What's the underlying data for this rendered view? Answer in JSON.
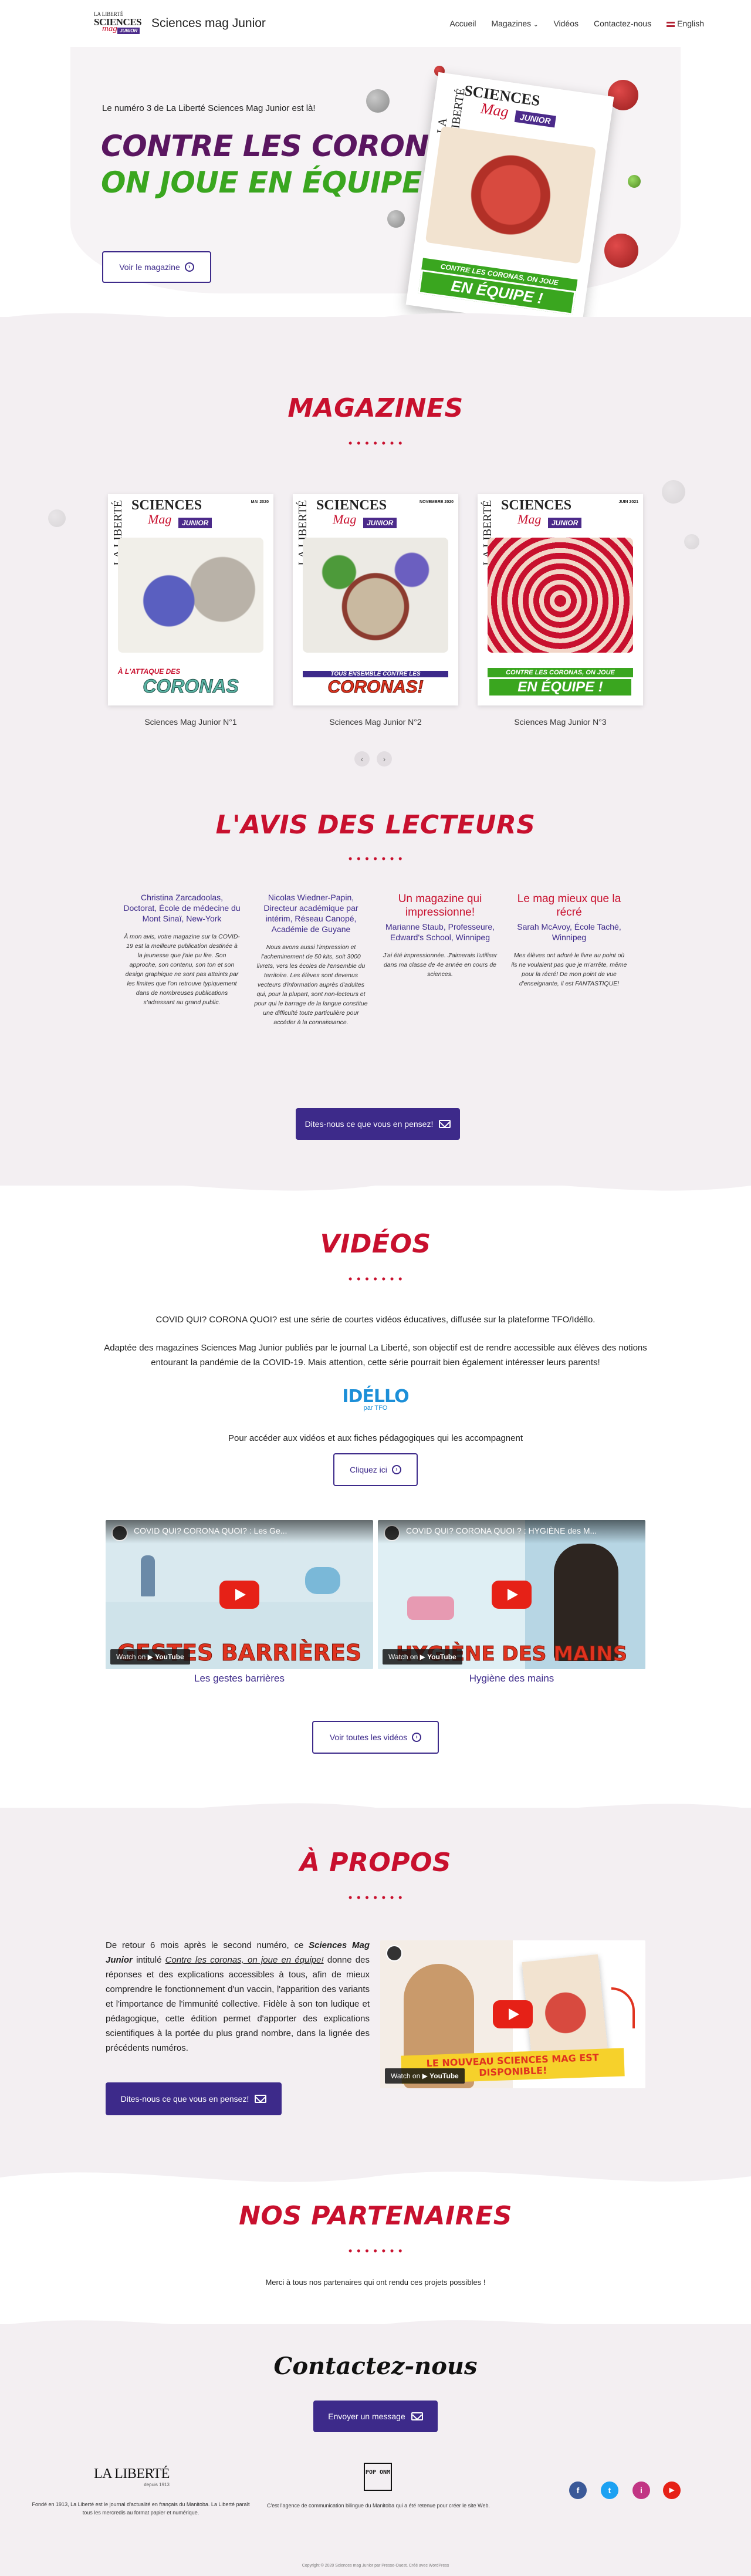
{
  "header": {
    "logo_line1": "LA LIBERTÉ",
    "logo_line2": "SCIENCES",
    "logo_line3": "mag",
    "logo_line4": "JUNIOR",
    "site_title": "Sciences mag Junior",
    "nav": [
      "Accueil",
      "Magazines",
      "Vidéos",
      "Contactez-nous",
      "English"
    ]
  },
  "hero": {
    "intro": "Le numéro 3 de La Liberté Sciences Mag Junior est là!",
    "title_line1": "CONTRE LES CORONAS,",
    "title_line2": "ON JOUE EN ÉQUIPE!",
    "button": "Voir le magazine",
    "cover_brand": "LA LIBERTÉ",
    "cover_sciences": "SCIENCES",
    "cover_mag": "Mag",
    "cover_junior": "JUNIOR",
    "cover_banner_small": "CONTRE LES CORONAS, ON JOUE",
    "cover_banner_big": "EN ÉQUIPE !"
  },
  "magazines": {
    "title": "MAGAZINES",
    "items": [
      {
        "caption": "Sciences Mag Junior N°1",
        "banner_small": "À L'ATTAQUE DES",
        "banner_big": "CORONAS",
        "date": "MAI 2020"
      },
      {
        "caption": "Sciences Mag Junior N°2",
        "banner_small": "TOUS ENSEMBLE CONTRE LES",
        "banner_big": "CORONAS!",
        "date": "NOVEMBRE 2020"
      },
      {
        "caption": "Sciences Mag Junior N°3",
        "banner_small": "CONTRE LES CORONAS, ON JOUE",
        "banner_big": "EN ÉQUIPE !",
        "date": "JUIN 2021"
      }
    ],
    "cover_brand": "LA LIBERTÉ",
    "cover_sciences": "SCIENCES",
    "cover_mag": "Mag",
    "cover_junior": "JUNIOR",
    "prev": "‹",
    "next": "›"
  },
  "reviews": {
    "title": "L'AVIS DES LECTEURS",
    "items": [
      {
        "heading": "",
        "name": "Christina Zarcadoolas, Doctorat, École de médecine du Mont Sinaï, New-York",
        "body": "À mon avis, votre magazine sur la COVID-19 est la meilleure publication destinée à la jeunesse que j'aie pu lire. Son approche, son contenu, son ton et son design graphique ne sont pas atteints par les limites que l'on retrouve typiquement dans de nombreuses publications s'adressant au grand public."
      },
      {
        "heading": "",
        "name": "Nicolas Wiedner-Papin, Directeur académique par intérim, Réseau Canopé, Académie de Guyane",
        "body": "Nous avons aussi l'impression et l'acheminement de 50 kits, soit 3000 livrets, vers les écoles de l'ensemble du territoire. Les élèves sont devenus vecteurs d'information auprès d'adultes qui, pour la plupart, sont non-lecteurs et pour qui le barrage de la langue constitue une difficulté toute particulière pour accéder à la connaissance."
      },
      {
        "heading": "Un magazine qui impressionne!",
        "name": "Marianne Staub, Professeure, Edward's School, Winnipeg",
        "body": "J'ai été impressionnée. J'aimerais l'utiliser dans ma classe de 4e année en cours de sciences."
      },
      {
        "heading": "Le mag mieux que la récré",
        "name": "Sarah McAvoy, École Taché, Winnipeg",
        "body": "Mes élèves ont adoré le livre au point où ils ne voulaient pas que je m'arrête, même pour la récré! De mon point de vue d'enseignante, il est FANTASTIQUE!"
      }
    ],
    "button": "Dites-nous ce que vous en pensez!"
  },
  "videos": {
    "title": "VIDÉOS",
    "p1": "COVID QUI? CORONA QUOI? est une série de courtes vidéos éducatives, diffusée sur la plateforme TFO/Idéllo.",
    "p2a": "Adaptée des magazines Sciences Mag Junior publiés par le journal La Liberté, son objectif est de rendre accessible aux élèves des notions",
    "p2b": "entourant la pandémie de la COVID-19. Mais attention, cette série pourrait bien également intéresser leurs parents!",
    "idello": "IDÉLLO",
    "idello_sub": "par TFO",
    "p3": "Pour accéder aux vidéos et aux fiches pédagogiques qui les accompagnent",
    "click_button": "Cliquez ici",
    "items": [
      {
        "top_title": "COVID QUI? CORONA QUOI? : Les Ge...",
        "overlay": "GESTES BARRIÈRES",
        "caption": "Les gestes barrières"
      },
      {
        "top_title": "COVID QUI? CORONA QUOI ? : HYGIÈNE des M...",
        "overlay": "HYGIÈNE DES MAINS",
        "caption": "Hygiène des mains"
      }
    ],
    "watch_on": "Watch on",
    "youtube": "YouTube",
    "all_button": "Voir toutes les vidéos"
  },
  "about": {
    "title": "À PROPOS",
    "text_1": "De retour 6 mois après le second numéro, ce ",
    "text_em": "Sciences Mag Junior",
    "text_2": " intitulé ",
    "text_u": "Contre les coronas, on joue en équipe!",
    "text_3": " donne des réponses et des explications accessibles à tous, afin de mieux comprendre le fonctionnement d'un vaccin, l'apparition des variants et l'importance de l'immunité collective. Fidèle à son ton ludique et pédagogique, cette édition permet d'apporter des explications scientifiques à la portée du plus grand nombre, dans la lignée des précédents numéros.",
    "button": "Dites-nous ce que vous en pensez!",
    "video_overlay": "LE NOUVEAU SCIENCES MAG EST DISPONIBLE!"
  },
  "partners": {
    "title": "NOS PARTENAIRES",
    "text": "Merci à tous nos partenaires qui ont rendu ces projets possibles !"
  },
  "contact": {
    "title": "Contactez-nous",
    "button": "Envoyer un message"
  },
  "footer": {
    "brand": "LA LIBERTÉ",
    "brand_sub": "depuis 1913",
    "brand_text_a": "Fondé en 1913, La Liberté est le journal d'actualité en français du Manitoba. La Liberté paraît",
    "brand_text_b": "tous les mercredis au format papier et numérique.",
    "pop_logo": "POP ONM",
    "pop_text": "C'est l'agence de communication bilingue du Manitoba qui a été retenue pour créer le site Web.",
    "social": [
      "f",
      "t",
      "i",
      "▶"
    ],
    "social_colors": [
      "#3b5998",
      "#1da1f2",
      "#c13584",
      "#e62117"
    ],
    "copyright": "Copyright © 2020 Sciences mag Junior par Presse-Ouest, Créé avec WordPress"
  },
  "colors": {
    "accent_red": "#c8102e",
    "accent_purple": "#3d2a8a",
    "hero_purple": "#5a1660",
    "hero_green": "#3aa61f",
    "section_bg": "#f3eff2"
  }
}
